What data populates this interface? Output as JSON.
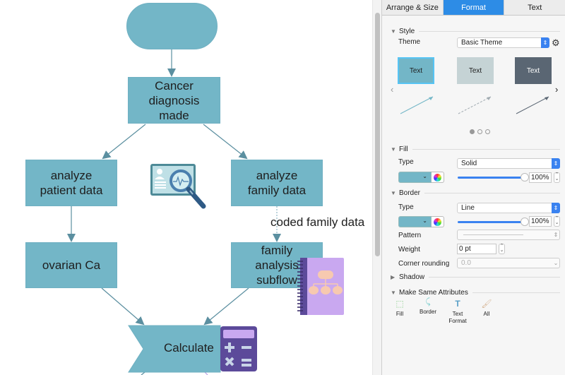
{
  "canvas": {
    "nodes": {
      "start": "",
      "cancer_diagnosis": [
        "Cancer",
        "diagnosis",
        "made"
      ],
      "analyze_patient": [
        "analyze",
        "patient data"
      ],
      "analyze_family": [
        "analyze",
        "family data"
      ],
      "ovarian": [
        "ovarian Ca"
      ],
      "family_subflow": [
        "family",
        "analysis",
        "subflow"
      ],
      "calculate": "Calculate"
    },
    "edge_label": "coded family data",
    "colors": {
      "node_fill": "#73b6c7",
      "edge": "#5b8fa0",
      "icon_purple": "#c9a8f0",
      "icon_dark_purple": "#5c4a9a"
    }
  },
  "inspector": {
    "tabs": [
      {
        "label": "Arrange & Size",
        "active": false
      },
      {
        "label": "Format",
        "active": true
      },
      {
        "label": "Text",
        "active": false
      }
    ],
    "style": {
      "header": "Style",
      "theme_label": "Theme",
      "theme_value": "Basic Theme",
      "cards": [
        {
          "label": "Text",
          "fill": "#73b6c7",
          "text_color": "#1e1e1e",
          "selected": true
        },
        {
          "label": "Text",
          "fill": "#c5d3d5",
          "text_color": "#1e1e1e",
          "selected": false
        },
        {
          "label": "Text",
          "fill": "#5a6673",
          "text_color": "#ffffff",
          "selected": false
        }
      ],
      "page_count": 3,
      "current_page": 1
    },
    "fill": {
      "header": "Fill",
      "type_label": "Type",
      "type_value": "Solid",
      "color": "#73b6c7",
      "opacity": "100%"
    },
    "border": {
      "header": "Border",
      "type_label": "Type",
      "type_value": "Line",
      "color": "#73b6c7",
      "opacity": "100%",
      "pattern_label": "Pattern",
      "weight_label": "Weight",
      "weight_value": "0 pt",
      "corner_label": "Corner rounding",
      "corner_value": "0.0"
    },
    "shadow": {
      "header": "Shadow"
    },
    "make_same": {
      "header": "Make Same Attributes",
      "buttons": [
        {
          "label": "Fill"
        },
        {
          "label": "Border"
        },
        {
          "label": "Text Format"
        },
        {
          "label": "All"
        }
      ]
    }
  }
}
